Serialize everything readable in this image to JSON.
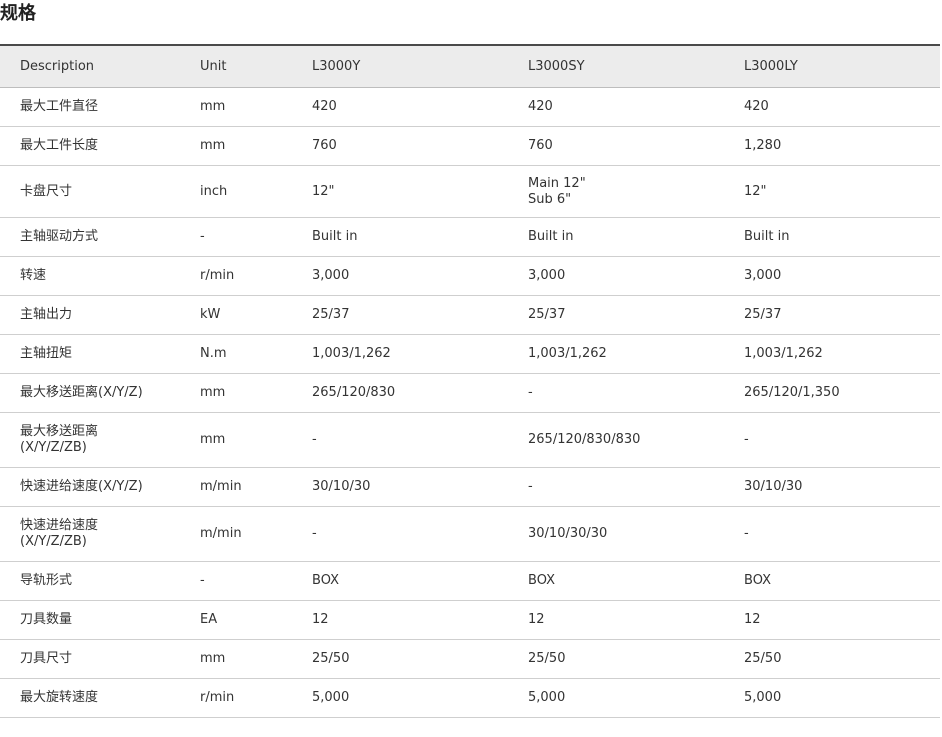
{
  "page": {
    "title": "规格"
  },
  "table": {
    "headers": [
      "Description",
      "Unit",
      "L3000Y",
      "L3000SY",
      "L3000LY"
    ],
    "rows": [
      [
        "最大工件直径",
        "mm",
        "420",
        "420",
        "420"
      ],
      [
        "最大工件长度",
        "mm",
        "760",
        "760",
        "1,280"
      ],
      [
        "卡盘尺寸",
        "inch",
        "12\"",
        "Main 12\"\nSub 6\"",
        "12\""
      ],
      [
        "主轴驱动方式",
        "-",
        "Built in",
        "Built in",
        "Built in"
      ],
      [
        "转速",
        "r/min",
        "3,000",
        "3,000",
        "3,000"
      ],
      [
        "主轴出力",
        "kW",
        "25/37",
        "25/37",
        "25/37"
      ],
      [
        "主轴扭矩",
        "N.m",
        "1,003/1,262",
        "1,003/1,262",
        "1,003/1,262"
      ],
      [
        "最大移送距离(X/Y/Z)",
        "mm",
        "265/120/830",
        "-",
        "265/120/1,350"
      ],
      [
        "最大移送距离\n(X/Y/Z/ZB)",
        "mm",
        "-",
        "265/120/830/830",
        "-"
      ],
      [
        "快速进给速度(X/Y/Z)",
        "m/min",
        "30/10/30",
        "-",
        "30/10/30"
      ],
      [
        "快速进给速度\n(X/Y/Z/ZB)",
        "m/min",
        "-",
        "30/10/30/30",
        "-"
      ],
      [
        "导轨形式",
        "-",
        "BOX",
        "BOX",
        "BOX"
      ],
      [
        "刀具数量",
        "EA",
        "12",
        "12",
        "12"
      ],
      [
        "刀具尺寸",
        "mm",
        "25/50",
        "25/50",
        "25/50"
      ],
      [
        "最大旋转速度",
        "r/min",
        "5,000",
        "5,000",
        "5,000"
      ]
    ]
  }
}
